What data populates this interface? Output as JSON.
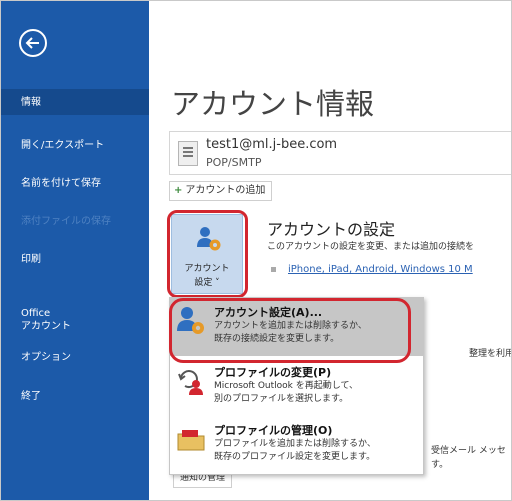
{
  "sidebar": {
    "items": [
      {
        "label": "情報"
      },
      {
        "label": "開く/エクスポート"
      },
      {
        "label": "名前を付けて保存"
      },
      {
        "label": "添付ファイルの保存"
      },
      {
        "label": "印刷"
      },
      {
        "label": "Office"
      },
      {
        "label": "アカウント"
      },
      {
        "label": "オプション"
      },
      {
        "label": "終了"
      }
    ]
  },
  "main": {
    "title": "アカウント情報",
    "account": {
      "email": "test1@ml.j-bee.com",
      "type": "POP/SMTP"
    },
    "add_account_label": "アカウントの追加",
    "settings_button": {
      "line1": "アカウント",
      "line2": "設定 ˅"
    },
    "section_title": "アカウントの設定",
    "section_desc": "このアカウントの設定を変更、または追加の接続を",
    "device_link": "iPhone, iPad, Android, Windows 10 M",
    "bg_text_1": "整理を利用して、",
    "bg_text_2": "受信メール メッセ",
    "bg_text_3": "す。",
    "notify_button": "通知の管理"
  },
  "dropdown": {
    "items": [
      {
        "title": "アカウント設定(A)...",
        "desc1": "アカウントを追加または削除するか、",
        "desc2": "既存の接続設定を変更します。"
      },
      {
        "title": "プロファイルの変更(P)",
        "desc1": "Microsoft Outlook を再起動して、",
        "desc2": "別のプロファイルを選択します。"
      },
      {
        "title": "プロファイルの管理(O)",
        "desc1": "プロファイルを追加または削除するか、",
        "desc2": "既存のプロファイル設定を変更します。"
      }
    ]
  },
  "colors": {
    "sidebar": "#1c5aa9",
    "highlight": "#d2262f",
    "link": "#2b62b3"
  }
}
